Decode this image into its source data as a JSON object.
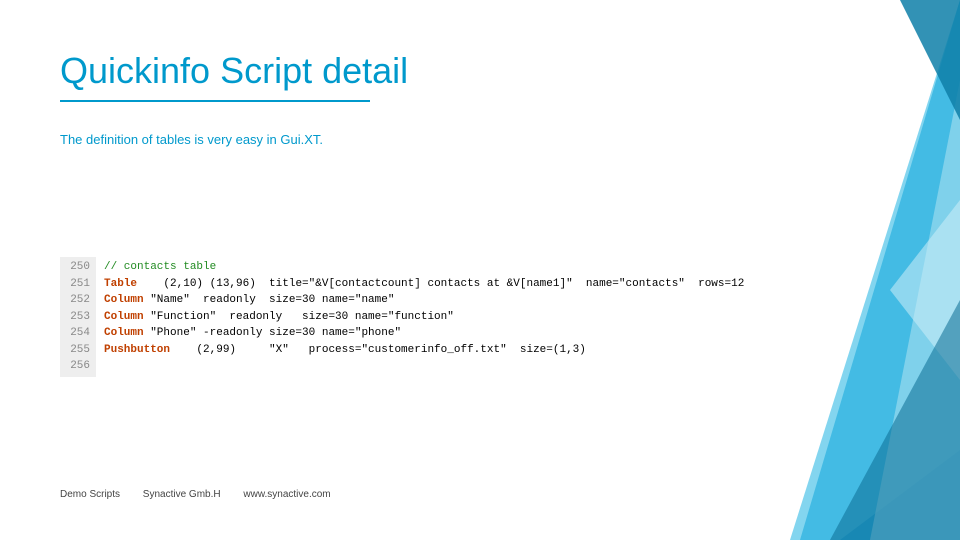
{
  "title": "Quickinfo  Script detail",
  "subtitle": "The definition of tables is very easy in Gui.XT.",
  "footer": {
    "a": "Demo Scripts",
    "b": "Synactive Gmb.H",
    "c": "www.synactive.com"
  },
  "code": {
    "lines": [
      "250",
      "251",
      "252",
      "253",
      "254",
      "255",
      "256"
    ],
    "rows": [
      {
        "pre": "",
        "kw": "",
        "rest": "// contacts table",
        "cls": "cmt"
      },
      {
        "pre": "",
        "kw": "Table",
        "rest": "    (2,10) (13,96)  title=\"&V[contactcount] contacts at &V[name1]\"  name=\"contacts\"  rows=12"
      },
      {
        "pre": "",
        "kw": "Column",
        "rest": " \"Name\"  readonly  size=30 name=\"name\""
      },
      {
        "pre": "",
        "kw": "Column",
        "rest": " \"Function\"  readonly   size=30 name=\"function\""
      },
      {
        "pre": "",
        "kw": "Column",
        "rest": " \"Phone\" -readonly size=30 name=\"phone\""
      },
      {
        "pre": "",
        "kw": "Pushbutton",
        "rest": "    (2,99)     \"X\"   process=\"customerinfo_off.txt\"  size=(1,3)"
      },
      {
        "pre": "",
        "kw": "",
        "rest": ""
      }
    ]
  }
}
